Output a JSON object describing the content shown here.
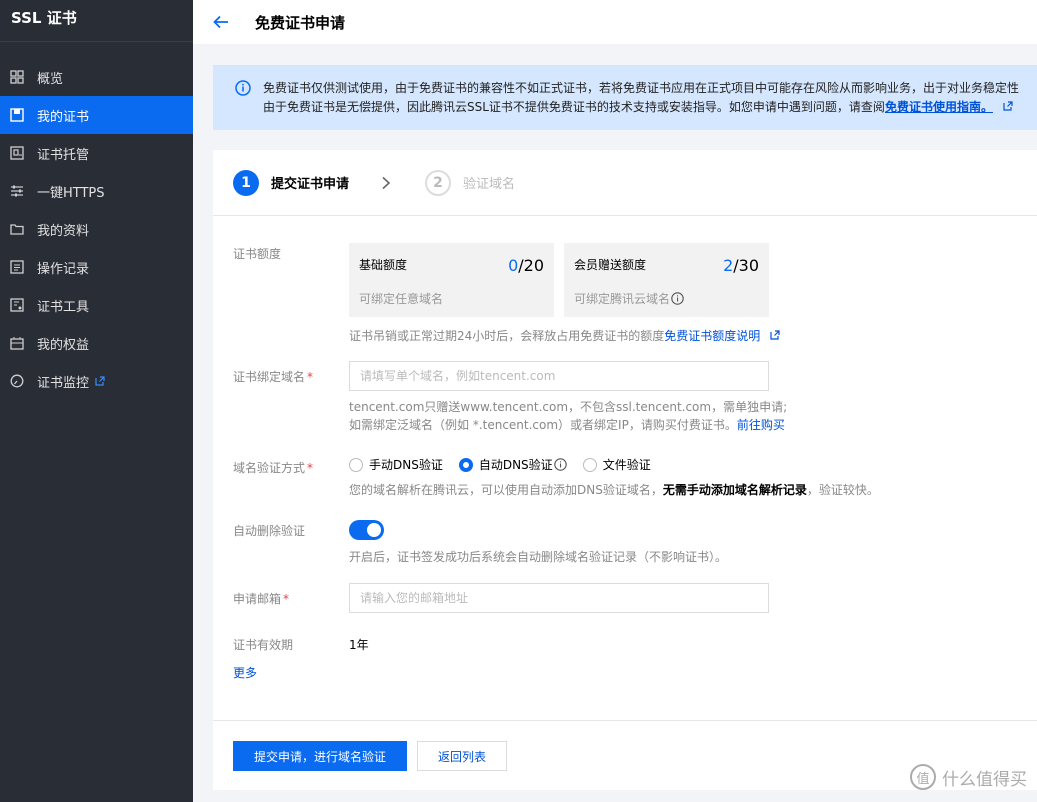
{
  "sidebar": {
    "title": "SSL 证书",
    "items": [
      {
        "label": "概览",
        "icon": "grid-icon"
      },
      {
        "label": "我的证书",
        "icon": "certificate-icon",
        "active": true
      },
      {
        "label": "证书托管",
        "icon": "hosting-icon"
      },
      {
        "label": "一键HTTPS",
        "icon": "sliders-icon"
      },
      {
        "label": "我的资料",
        "icon": "folder-icon"
      },
      {
        "label": "操作记录",
        "icon": "log-icon"
      },
      {
        "label": "证书工具",
        "icon": "tool-icon"
      },
      {
        "label": "我的权益",
        "icon": "gift-icon"
      },
      {
        "label": "证书监控",
        "icon": "monitor-icon"
      }
    ]
  },
  "header": {
    "title": "免费证书申请"
  },
  "notice": {
    "line1": "免费证书仅供测试使用，由于免费证书的兼容性不如正式证书，若将免费证书应用在正式项目中可能存在风险从而影响业务，出于对业务稳定性",
    "line2_prefix": "由于免费证书是无偿提供，因此腾讯云SSL证书不提供免费证书的技术支持或安装指导。如您申请中遇到问题，请查阅",
    "line2_link": "免费证书使用指南。"
  },
  "steps": [
    {
      "number": "1",
      "label": "提交证书申请"
    },
    {
      "number": "2",
      "label": "验证域名"
    }
  ],
  "form": {
    "quota": {
      "label": "证书额度",
      "basic": {
        "title": "基础额度",
        "used": "0",
        "total": "/20",
        "desc": "可绑定任意域名"
      },
      "member": {
        "title": "会员赠送额度",
        "used": "2",
        "total": "/30",
        "desc": "可绑定腾讯云域名"
      },
      "hint_text": "证书吊销或正常过期24小时后，会释放占用免费证书的额度",
      "hint_link": "免费证书额度说明"
    },
    "domain": {
      "label": "证书绑定域名",
      "placeholder": "请填写单个域名，例如tencent.com",
      "hint_line1": "tencent.com只赠送www.tencent.com，不包含ssl.tencent.com，需单独申请;",
      "hint_line2_prefix": "如需绑定泛域名（例如 *.tencent.com）或者绑定IP，请购买付费证书。",
      "hint_line2_link": "前往购买"
    },
    "verify": {
      "label": "域名验证方式",
      "options": [
        "手动DNS验证",
        "自动DNS验证",
        "文件验证"
      ],
      "selected": "自动DNS验证",
      "hint_prefix": "您的域名解析在腾讯云，可以使用自动添加DNS验证域名，",
      "hint_bold": "无需手动添加域名解析记录",
      "hint_suffix": "，验证较快。"
    },
    "auto_delete": {
      "label": "自动删除验证",
      "enabled": true,
      "hint": "开启后，证书签发成功后系统会自动删除域名验证记录（不影响证书）。"
    },
    "email": {
      "label": "申请邮箱",
      "placeholder": "请输入您的邮箱地址"
    },
    "validity": {
      "label": "证书有效期",
      "value": "1年"
    },
    "more_label": "更多"
  },
  "buttons": {
    "submit": "提交申请，进行域名验证",
    "back": "返回列表"
  },
  "watermark": {
    "logo": "值",
    "text": "什么值得买"
  },
  "colors": {
    "sidebar_bg": "#292d36",
    "accent": "#0a6bf1",
    "link": "#0052d9",
    "notice_bg": "#d5e7fe",
    "required": "#e54545"
  }
}
